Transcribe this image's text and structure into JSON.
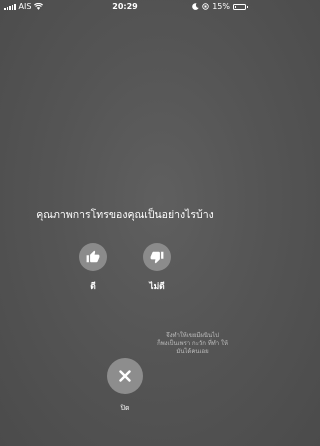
{
  "status_bar": {
    "carrier": "AIS",
    "time": "20:29",
    "battery": "15%",
    "battery_level": 0.15
  },
  "prompt": "คุณภาพการโทรของคุณเป็นอย่างไรบ้าง",
  "ratings": {
    "good_label": "ดี",
    "bad_label": "ไม่ดี"
  },
  "hint": [
    "จึงทำให้เขยมีผนินไป",
    "ก็พงเป็นเพรา กะวัก ที่ทำ ให้",
    "มันได้คนเอย"
  ],
  "close": {
    "label": "ปิด"
  }
}
